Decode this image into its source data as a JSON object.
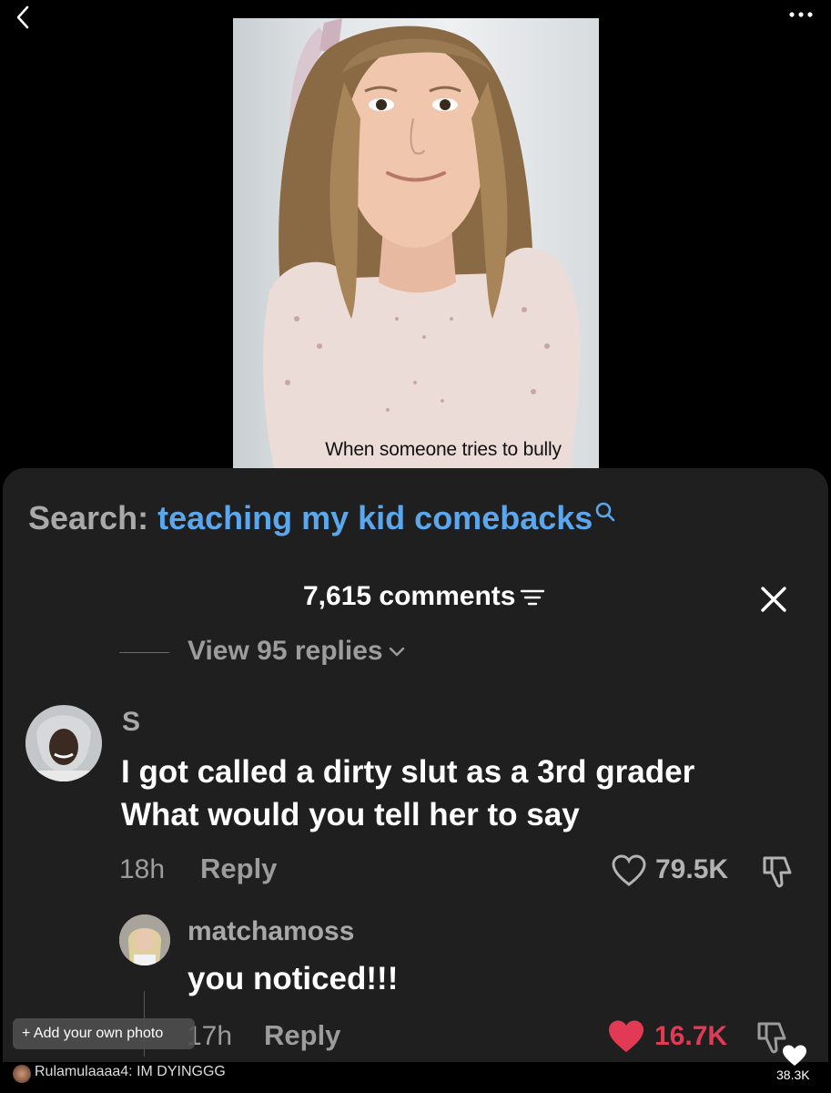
{
  "video": {
    "caption": "When someone tries to bully"
  },
  "search": {
    "label": "Search:",
    "query": "teaching my kid comebacks"
  },
  "comments": {
    "header": "7,615 comments",
    "view_replies": "View 95 replies",
    "main": {
      "author": "S",
      "text_line1": "I got called a dirty slut as a 3rd grader",
      "text_line2": "What would you tell her to say",
      "time": "18h",
      "reply_label": "Reply",
      "likes": "79.5K"
    },
    "reply": {
      "author": "matchamoss",
      "text": "you noticed!!!",
      "time": "17h",
      "reply_label": "Reply",
      "likes": "16.7K",
      "liked": true
    }
  },
  "overlay": {
    "add_photo": "+ Add your own photo",
    "bottom_comment": "Rulamulaaaa4: IM DYINGGG",
    "bottom_likes": "38.3K"
  },
  "colors": {
    "accent_blue": "#5aa7ee",
    "like_red": "#e23a55",
    "sheet_bg": "#1f1f1f"
  },
  "icons": [
    "back-icon",
    "more-icon",
    "search-icon",
    "filter-icon",
    "close-icon",
    "chevron-down-icon",
    "heart-icon",
    "dislike-icon"
  ]
}
